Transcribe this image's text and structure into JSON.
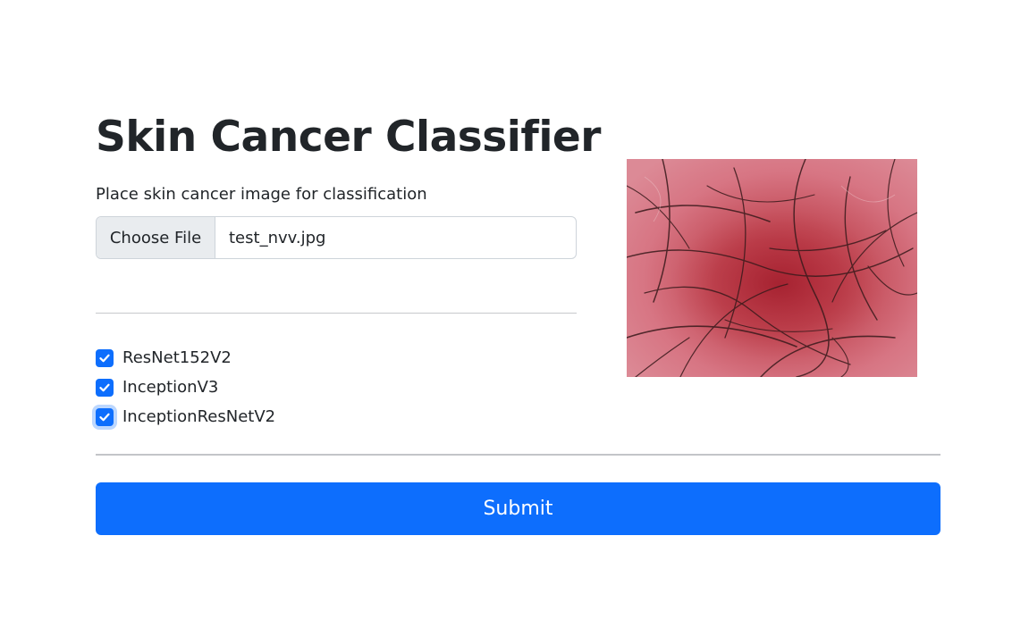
{
  "header": {
    "title": "Skin Cancer Classifier"
  },
  "upload": {
    "instruction": "Place skin cancer image for classification",
    "button_label": "Choose File",
    "file_name": "test_nvv.jpg"
  },
  "models": [
    {
      "label": "ResNet152V2",
      "checked": true
    },
    {
      "label": "InceptionV3",
      "checked": true
    },
    {
      "label": "InceptionResNetV2",
      "checked": true
    }
  ],
  "submit": {
    "label": "Submit"
  },
  "colors": {
    "primary": "#0d6efd",
    "text": "#212529",
    "border": "#ced4da"
  }
}
